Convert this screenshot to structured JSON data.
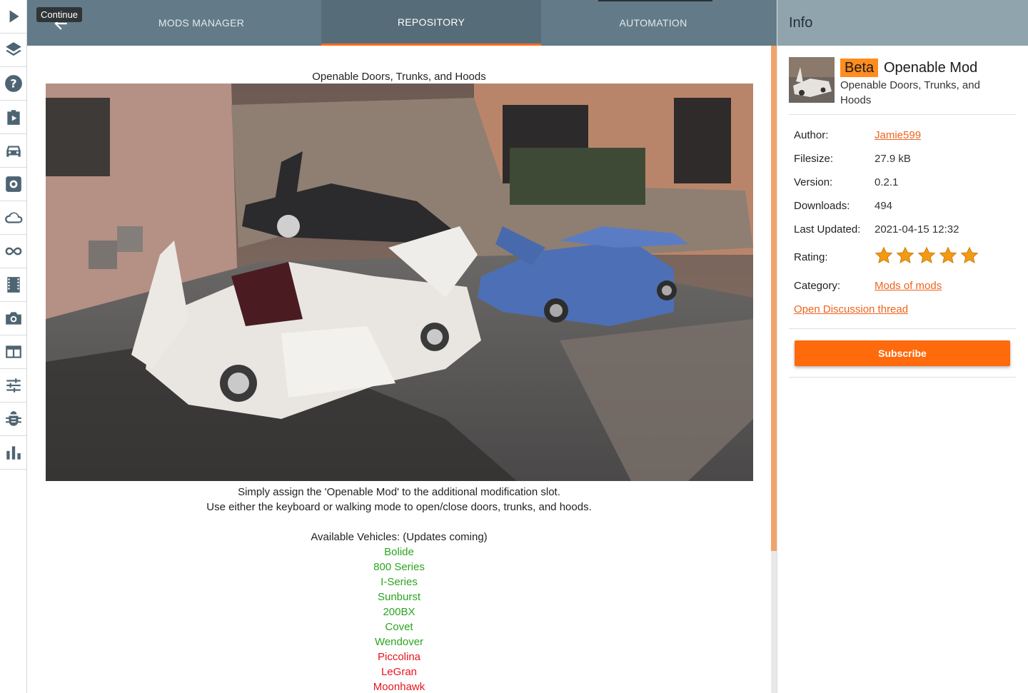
{
  "tooltip": "Continue",
  "tabs": [
    {
      "label": "MODS MANAGER"
    },
    {
      "label": "REPOSITORY"
    },
    {
      "label": "AUTOMATION"
    }
  ],
  "sidebar_icons": [
    "play-icon",
    "layers-icon",
    "help-icon",
    "clipboard-play-icon",
    "car-icon",
    "settings-icon",
    "cloud-icon",
    "infinity-icon",
    "film-icon",
    "camera-icon",
    "view-icon",
    "sliders-icon",
    "bug-icon",
    "stats-icon"
  ],
  "content": {
    "title": "Openable Doors, Trunks, and Hoods",
    "desc_line1": "Simply assign the 'Openable Mod' to the additional modification slot.",
    "desc_line2": "Use either the keyboard or walking mode to open/close doors, trunks, and hoods.",
    "vehicles_header": "Available Vehicles: (Updates coming)",
    "vehicles": [
      {
        "name": "Bolide",
        "status": "green"
      },
      {
        "name": "800 Series",
        "status": "green"
      },
      {
        "name": "I-Series",
        "status": "green"
      },
      {
        "name": "Sunburst",
        "status": "green"
      },
      {
        "name": "200BX",
        "status": "green"
      },
      {
        "name": "Covet",
        "status": "green"
      },
      {
        "name": "Wendover",
        "status": "green"
      },
      {
        "name": "Piccolina",
        "status": "red"
      },
      {
        "name": "LeGran",
        "status": "red"
      },
      {
        "name": "Moonhawk",
        "status": "red"
      }
    ]
  },
  "info": {
    "header": "Info",
    "badge": "Beta",
    "name": "Openable Mod",
    "subtitle": "Openable Doors, Trunks, and Hoods",
    "author_label": "Author:",
    "author": "Jamie599",
    "filesize_label": "Filesize:",
    "filesize": "27.9 kB",
    "version_label": "Version:",
    "version": "0.2.1",
    "downloads_label": "Downloads:",
    "downloads": "494",
    "updated_label": "Last Updated:",
    "updated": "2021-04-15 12:32",
    "rating_label": "Rating:",
    "rating": 5,
    "category_label": "Category:",
    "category": "Mods of mods",
    "discussion": "Open Discussion thread",
    "subscribe": "Subscribe"
  },
  "colors": {
    "accent": "#ff6a0d",
    "topbar": "#637b88",
    "info_header": "#8fa4ad",
    "vehicle_available": "#2aa520",
    "vehicle_unavailable": "#e8141c"
  }
}
